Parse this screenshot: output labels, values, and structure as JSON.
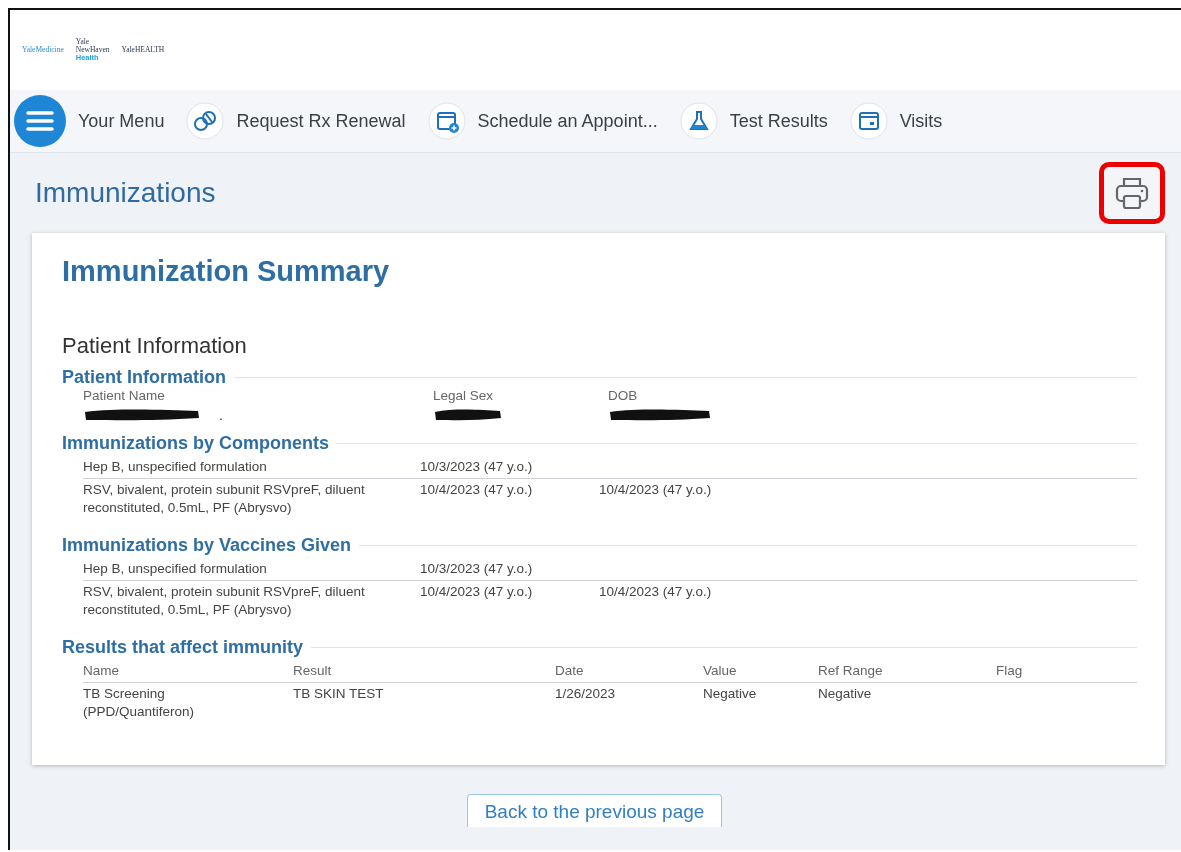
{
  "logos": [
    {
      "lines": [
        "YaleMedicine"
      ]
    },
    {
      "lines": [
        "Yale",
        "NewHaven",
        "Health"
      ]
    },
    {
      "lines": [
        "YaleHEALTH"
      ]
    }
  ],
  "nav": [
    {
      "label": "Your Menu"
    },
    {
      "label": "Request Rx Renewal"
    },
    {
      "label": "Schedule an Appoint..."
    },
    {
      "label": "Test Results"
    },
    {
      "label": "Visits"
    }
  ],
  "page_title": "Immunizations",
  "print_button": {
    "highlighted": true
  },
  "summary": {
    "title": "Immunization Summary",
    "subtitle": "Patient Information",
    "patient_info": {
      "heading": "Patient Information",
      "fields": [
        {
          "label": "Patient Name",
          "value": "."
        },
        {
          "label": "Legal Sex"
        },
        {
          "label": "DOB"
        }
      ]
    },
    "sections": [
      {
        "heading": "Immunizations by Components",
        "rows": [
          [
            "Hep B, unspecified formulation",
            "10/3/2023 (47 y.o.)",
            null
          ],
          [
            "RSV, bivalent, protein subunit RSVpreF, diluent reconstituted, 0.5mL, PF (Abrysvo)",
            "10/4/2023 (47 y.o.)",
            "10/4/2023 (47 y.o.)"
          ]
        ]
      },
      {
        "heading": "Immunizations by Vaccines Given",
        "rows": [
          [
            "Hep B, unspecified formulation",
            "10/3/2023 (47 y.o.)",
            null
          ],
          [
            "RSV, bivalent, protein subunit RSVpreF, diluent reconstituted, 0.5mL, PF (Abrysvo)",
            "10/4/2023 (47 y.o.)",
            "10/4/2023 (47 y.o.)"
          ]
        ]
      },
      {
        "heading": "Results that affect immunity",
        "columns": [
          "Name",
          "Result",
          "Date",
          "Value",
          "Ref Range",
          "Flag"
        ],
        "rows": [
          [
            "TB Screening (PPD/Quantiferon)",
            "TB SKIN TEST",
            "1/26/2023",
            "Negative",
            "Negative",
            null
          ]
        ]
      }
    ]
  },
  "back_button": "Back to the previous page"
}
